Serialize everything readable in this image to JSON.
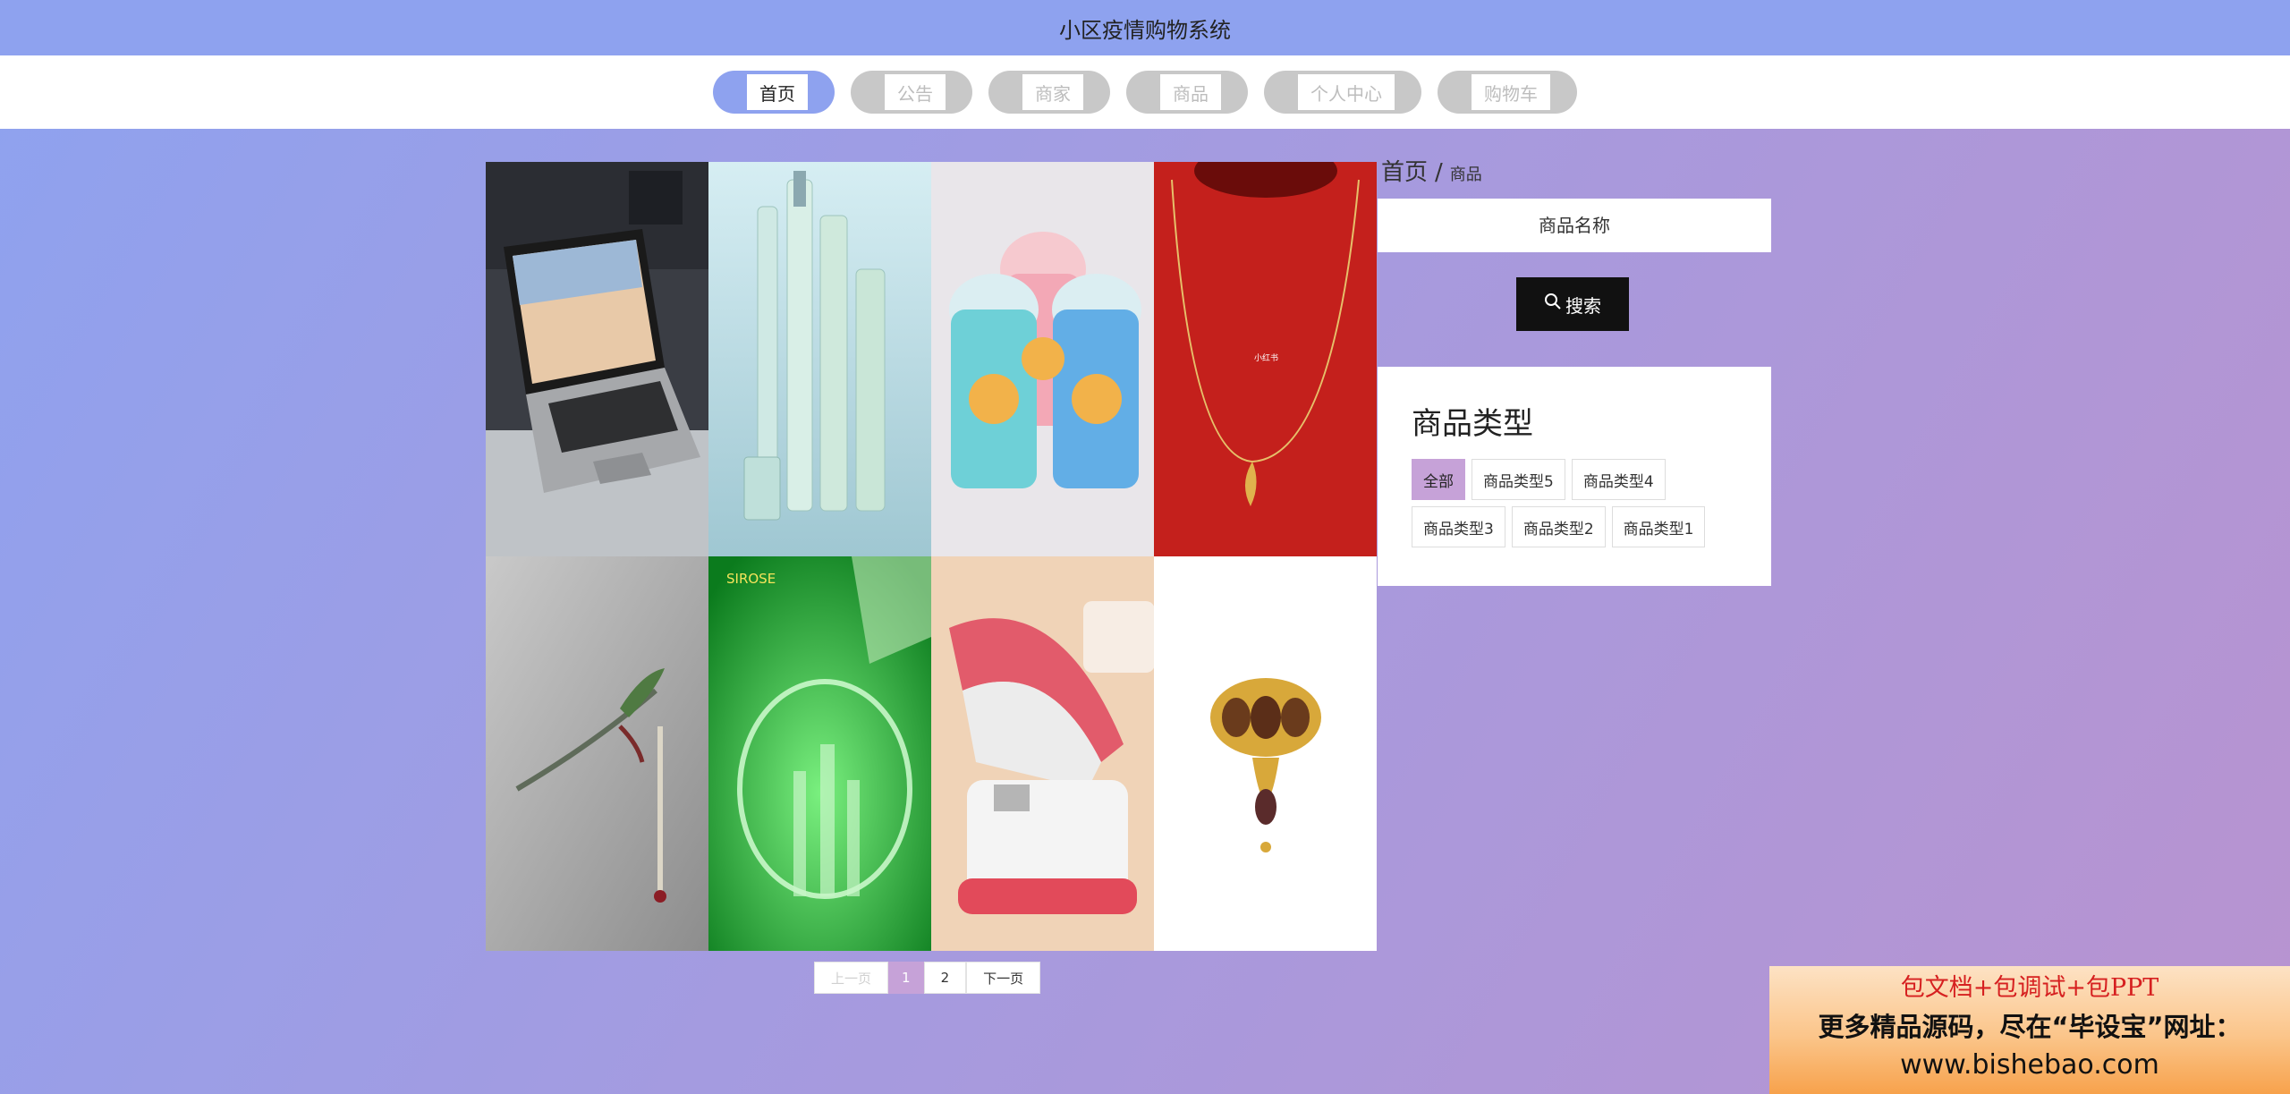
{
  "header": {
    "title": "小区疫情购物系统"
  },
  "nav": [
    {
      "label": "首页",
      "active": true
    },
    {
      "label": "公告"
    },
    {
      "label": "商家"
    },
    {
      "label": "商品"
    },
    {
      "label": "个人中心"
    },
    {
      "label": "购物车"
    }
  ],
  "products": [
    {
      "name": "laptop"
    },
    {
      "name": "skincare-bottles"
    },
    {
      "name": "kids-cups"
    },
    {
      "name": "gold-necklace"
    },
    {
      "name": "hairpin"
    },
    {
      "name": "green-liquid-poster"
    },
    {
      "name": "stapler"
    },
    {
      "name": "brooch"
    }
  ],
  "pagination": {
    "prev": "上一页",
    "pages": [
      "1",
      "2"
    ],
    "current": "1",
    "next": "下一页"
  },
  "breadcrumb": {
    "home": "首页",
    "sep": "/",
    "current": "商品"
  },
  "search": {
    "placeholder": "商品名称",
    "button": "搜索",
    "icon": "search-icon"
  },
  "types": {
    "heading": "商品类型",
    "items": [
      "全部",
      "商品类型5",
      "商品类型4",
      "商品类型3",
      "商品类型2",
      "商品类型1"
    ],
    "active": "全部"
  },
  "promo": {
    "line1": "包文档+包调试+包PPT",
    "line2": "更多精品源码，尽在“毕设宝”网址：",
    "line3": "www.bishebao.com"
  },
  "colors": {
    "accent": "#8ea2ef",
    "chip_active": "#c6a2d8",
    "nav_inactive": "#c8c8c8"
  }
}
